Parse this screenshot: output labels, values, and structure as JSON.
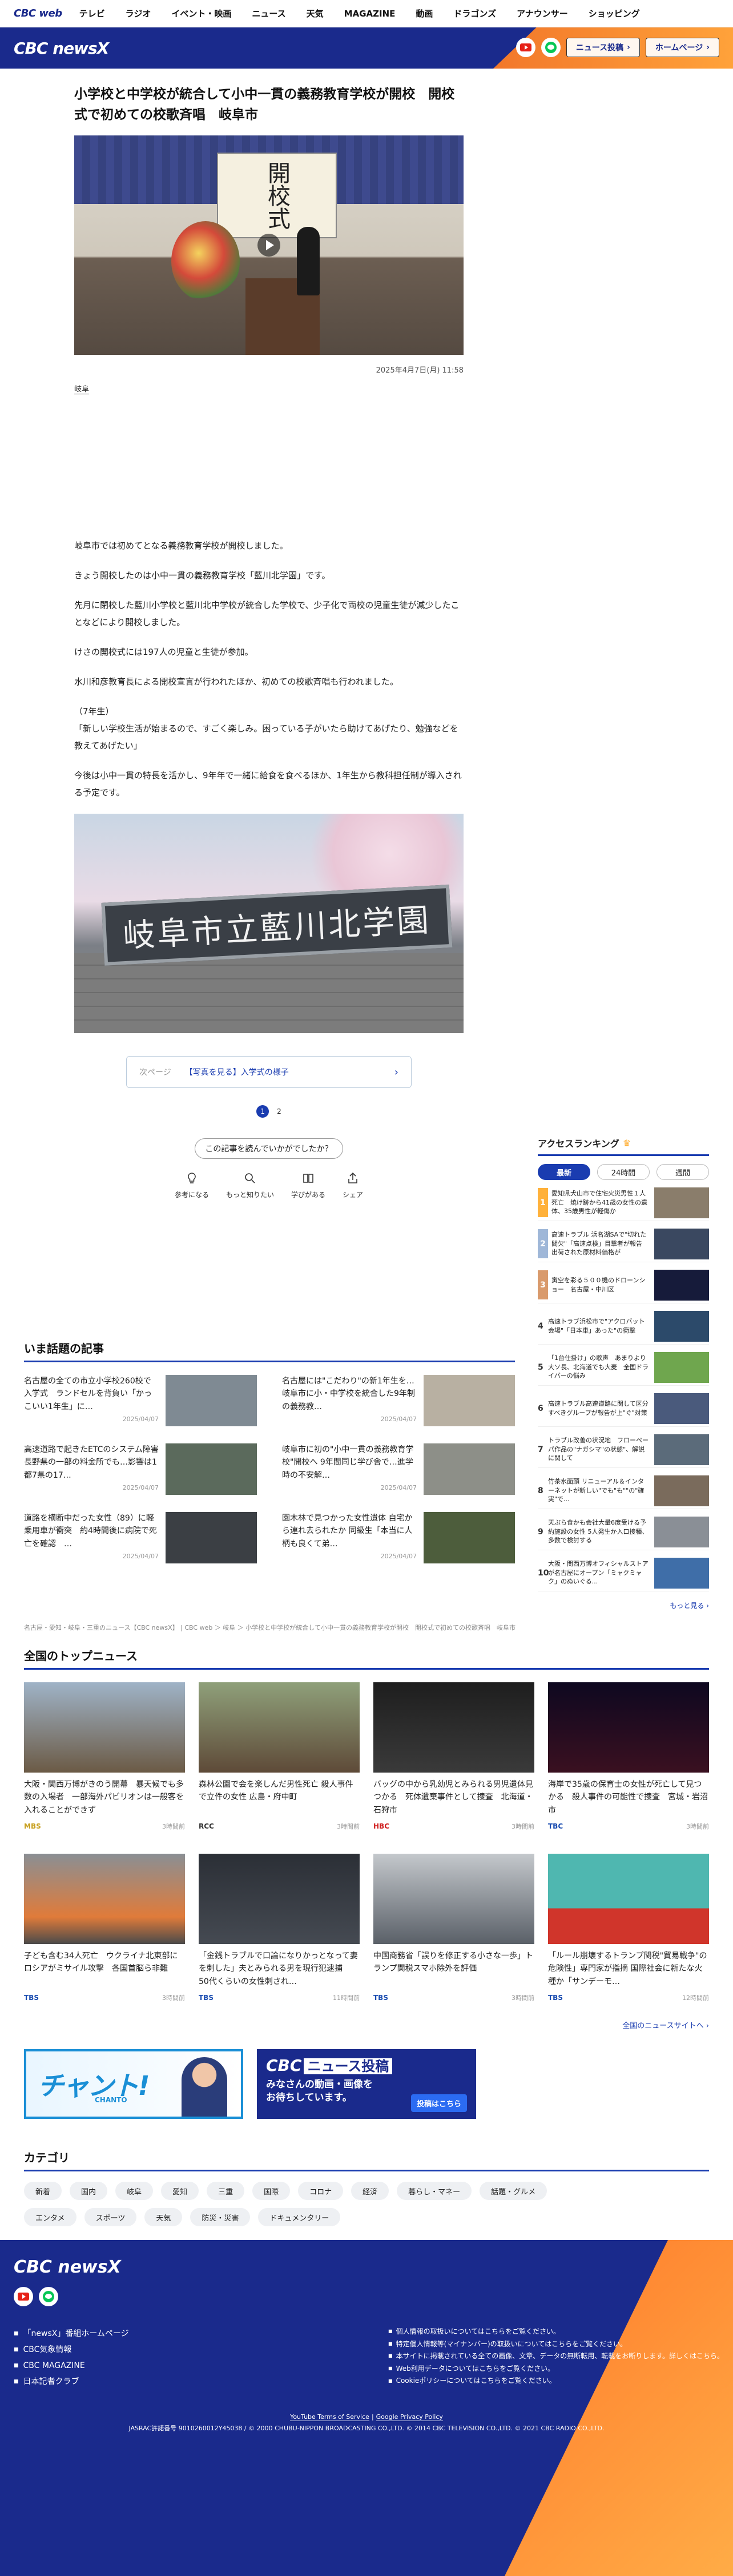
{
  "topnav": {
    "logo": "CBC web",
    "items": [
      "テレビ",
      "ラジオ",
      "イベント・映画",
      "ニュース",
      "天気",
      "MAGAZINE",
      "動画",
      "ドラゴンズ",
      "アナウンサー",
      "ショッピング"
    ]
  },
  "brand": {
    "logo": "CBC newsX",
    "post_btn": "ニュース投稿",
    "home_btn": "ホームページ"
  },
  "article": {
    "headline": "小学校と中学校が統合して小中一貫の義務教育学校が開校　開校式で初めての校歌斉唱　岐阜市",
    "hero_banner": "開校式",
    "date": "2025年4月7日(月) 11:58",
    "area": "岐阜",
    "paragraphs": [
      "岐阜市では初めてとなる義務教育学校が開校しました。",
      "きょう開校したのは小中一貫の義務教育学校「藍川北学園」です。",
      "先月に閉校した藍川小学校と藍川北中学校が統合した学校で、少子化で両校の児童生徒が減少したことなどにより開校しました。",
      "けさの開校式には197人の児童と生徒が参加。",
      "水川和彦教育長による開校宣言が行われたほか、初めての校歌斉唱も行われました。",
      "（7年生）\n「新しい学校生活が始まるので、すごく楽しみ。困っている子がいたら助けてあげたり、勉強などを教えてあげたい」",
      "今後は小中一貫の特長を活かし、9年年で一緒に給食を食べるほか、1年生から教科担任制が導入される予定です。"
    ],
    "photo2_sign": "岐阜市立藍川北学園",
    "next_prefix": "次ページ",
    "next_title": "【写真を見る】入学式の様子",
    "pages": [
      "1",
      "2"
    ],
    "feedback_q": "この記事を読んでいかがでしたか？",
    "reactions": [
      "参考になる",
      "もっと知りたい",
      "学びがある",
      "シェア"
    ]
  },
  "ranking": {
    "title": "アクセスランキング",
    "tabs": [
      "最新",
      "24時間",
      "週間"
    ],
    "items": [
      {
        "num": "1",
        "text": "愛知県犬山市で住宅火災男性１人死亡　焼け跡から41歳の女性の遺体、35歳男性が軽傷か"
      },
      {
        "num": "2",
        "text": "高速トラブル 浜名湖SAで\"切れた間欠\"「高速点検」目撃者が報告　出荷された原材料価格が"
      },
      {
        "num": "3",
        "text": "寅空を彩る５００機のドローンショー　名古屋・中川区"
      },
      {
        "num": "4",
        "text": "高速トラブ浜松市で\"アクロバット会場\"「日本車」あった\"の衝撃"
      },
      {
        "num": "5",
        "text": "「1台仕掛け」の歌声　あまりより大ソ長、北海道でも大麦　全国ドライバーの悩み"
      },
      {
        "num": "6",
        "text": "高速トラブル高速道路に関して区分すべきグループが報告が上\"ぐ\"対策"
      },
      {
        "num": "7",
        "text": "トラブル改善の状況地　フローペーパ作品の\"ナガシマ\"の状態\"、解説に関して"
      },
      {
        "num": "8",
        "text": "竹茶水面頭 リニューアル＆インターネットが新しい\"でも\"も\"\"の\"確実\"で..."
      },
      {
        "num": "9",
        "text": "天ぷら食かも会社大量6度受ける予約施設の女性 5人発生か入口接種、多数で検討する"
      },
      {
        "num": "10",
        "text": "大阪・関西万博オフィシャルストアが名古屋にオープン「ミャクミャク」のぬいぐる..."
      }
    ],
    "more": "もっと見る"
  },
  "hot": {
    "title": "いま話題の記事",
    "items": [
      {
        "text": "名古屋の全ての市立小学校260校で入学式　ランドセルを背負い「かっこいい1年生」に…",
        "time": "2025/04/07"
      },
      {
        "text": "名古屋には\"こだわり\"の新1年生を…　岐阜市に小・中学校を統合した9年制の義務教…",
        "time": "2025/04/07"
      },
      {
        "text": "高速道路で起きたETCのシステム障害 長野県の一部の料金所でも…影響は1都7県の17…",
        "time": "2025/04/07"
      },
      {
        "text": "岐阜市に初の\"小中一貫の義務教育学校\"開校へ 9年間同じ学び舎で…進学時の不安解…",
        "time": "2025/04/07"
      },
      {
        "text": "道路を横断中だった女性（89）に軽乗用車が衝突　約4時間後に病院で死亡を確認　…",
        "time": "2025/04/07"
      },
      {
        "text": "園木林で見つかった女性遺体 自宅から連れ去られたか 同級生「本当に人柄も良くて弟…",
        "time": "2025/04/07"
      }
    ]
  },
  "breadcrumb": "名古屋・愛知・岐阜・三重のニュース【CBC newsX】 | CBC web ＞ 岐阜 ＞ 小学校と中学校が統合して小中一貫の義務教育学校が開校　開校式で初めての校歌斉唱　岐阜市",
  "national": {
    "title": "全国のトップニュース",
    "items": [
      {
        "text": "大阪・関西万博がきのう開幕　暴天候でも多数の入場者　一部海外パビリオンは一般客を入れることができず",
        "src": "MBS",
        "time": "3時間前",
        "color": "#c8a06a"
      },
      {
        "text": "森林公園で会を楽しんだ男性死亡 殺人事件で立件の女性 広島・府中町",
        "src": "RCC",
        "time": "3時間前",
        "color": "#8a6a52"
      },
      {
        "text": "バッグの中から乳幼児とみられる男児遺体見つかる　死体遺棄事件として捜査　北海道・石狩市",
        "src": "HBC",
        "time": "3時間前",
        "color": "#2b2b2b"
      },
      {
        "text": "海岸で35歳の保育士の女性が死亡して見つかる　殺人事件の可能性で捜査　宮城・岩沼市",
        "src": "TBC",
        "time": "3時間前",
        "color": "#1a1030"
      },
      {
        "text": "子ども含む34人死亡　ウクライナ北東部にロシアがミサイル攻撃　各国首脳ら非難",
        "src": "TBS",
        "time": "3時間前",
        "color": "#6b6f72"
      },
      {
        "text": "「金銭トラブルで口論になりかっとなって妻を刺した」夫とみられる男を現行犯逮捕　50代くらいの女性刺され…",
        "src": "TBS",
        "time": "11時間前",
        "color": "#2e3238"
      },
      {
        "text": "中国商務省「誤りを修正する小さな一歩」トランプ関税スマホ除外を評価",
        "src": "TBS",
        "time": "3時間前",
        "color": "#707880"
      },
      {
        "text": "「ルール崩壊するトランプ関税\"貿易戦争\"の危険性」専門家が指摘 国際社会に新たな火種か「サンデーモ…",
        "src": "TBS",
        "time": "12時間前",
        "color": "#c84b3a"
      }
    ],
    "more": "全国のニュースサイトへ"
  },
  "banners": {
    "chanto": "チャント!",
    "chanto_sub": "CHANTO",
    "post_title": "CBC",
    "post_badge": "ニュース投稿",
    "post_sub": "みなさんの動画・画像を\nお待ちしています。",
    "post_btn": "投稿はこちら"
  },
  "category": {
    "title": "カテゴリ",
    "chips": [
      "新着",
      "国内",
      "岐阜",
      "愛知",
      "三重",
      "国際",
      "コロナ",
      "経済",
      "暮らし・マネー",
      "話題・グルメ",
      "エンタメ",
      "スポーツ",
      "天気",
      "防災・災害",
      "ドキュメンタリー"
    ]
  },
  "footer": {
    "logo": "CBC newsX",
    "links": [
      "「newsX」番組ホームページ",
      "CBC気象情報",
      "CBC MAGAZINE",
      "日本記者クラブ"
    ],
    "policy_links": [
      "個人情報の取扱いについてはこちらをご覧ください。",
      "特定個人情報等(マイナンバー)の取扱いについてはこちらをご覧ください。",
      "本サイトに掲載されている全ての画像、文章、データの無断転用、転載をお断りします。詳しくはこちら。",
      "Web利用データについてはこちらをご覧ください。",
      "Cookieポリシーについてはこちらをご覧ください。"
    ],
    "terms": "YouTube Terms of Service",
    "privacy": "Google Privacy Policy",
    "copyright": "JASRAC許諾番号 9010260012Y45038 / © 2000 CHUBU-NIPPON BROADCASTING CO.,LTD. © 2014 CBC TELEVISION CO.,LTD. © 2021 CBC RADIO CO.,LTD."
  },
  "colors": {
    "navy": "#1a2a8c",
    "orange": "#f2772a",
    "link": "#1a3cb0"
  }
}
